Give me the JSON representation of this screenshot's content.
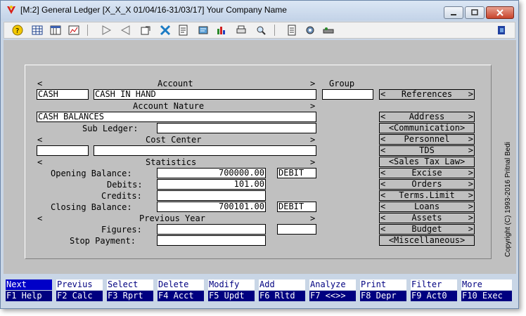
{
  "window": {
    "title": "[M:2]  General Ledger  [X_X_X  01/04/16-31/03/17]  Your Company Name"
  },
  "toolbar": {
    "icons": [
      "help-icon",
      "grid-icon",
      "table-icon",
      "chart-icon",
      "next-arrow-icon",
      "prev-arrow-icon",
      "properties-icon",
      "tools-icon",
      "document-icon",
      "refresh-icon",
      "bar-chart-icon",
      "print-icon",
      "find-icon",
      "notes-icon",
      "settings-icon",
      "switch-icon",
      "exit-icon"
    ]
  },
  "form": {
    "left_bracket": "<",
    "right_bracket": ">",
    "account_label": "Account",
    "account_code": "CASH",
    "account_name": "CASH IN HAND",
    "group_label": "Group",
    "group_value": "",
    "account_nature_label": "Account Nature",
    "account_nature_value": "CASH BALANCES",
    "sub_ledger_label": "Sub Ledger:",
    "sub_ledger_value": "",
    "cost_center_label": "Cost Center",
    "cost_center_code": "",
    "cost_center_name": "",
    "statistics_label": "Statistics",
    "opening_balance_label": "Opening Balance:",
    "opening_balance_value": "700000.00",
    "opening_balance_type": "DEBIT",
    "debits_label": "Debits:",
    "debits_value": "101.00",
    "credits_label": "Credits:",
    "credits_value": "",
    "closing_balance_label": "Closing Balance:",
    "closing_balance_value": "700101.00",
    "closing_balance_type": "DEBIT",
    "previous_year_label": "Previous Year",
    "figures_label": "Figures:",
    "figures_value": "",
    "figures_type": "",
    "stop_payment_label": "Stop Payment:",
    "stop_payment_value": ""
  },
  "side_buttons": {
    "references": "References",
    "address": "Address",
    "communication": "<Communication>",
    "personnel": "Personnel",
    "tds": "TDS",
    "sales_tax_law": "<Sales Tax Law>",
    "excise": "Excise",
    "orders": "Orders",
    "terms_limit": "Terms.Limit",
    "loans": "Loans",
    "assets": "Assets",
    "budget": "Budget",
    "miscellaneous": "<Miscellaneous>"
  },
  "copyright": "Copyright (C) 1993-2016  Pritnal Bedi",
  "function_keys": [
    {
      "top": "Next",
      "bottom": "F1 Help"
    },
    {
      "top": "Previus",
      "bottom": "F2 Calc"
    },
    {
      "top": "Select",
      "bottom": "F3 Rprt"
    },
    {
      "top": "Delete",
      "bottom": "F4 Acct"
    },
    {
      "top": "Modify",
      "bottom": "F5 Updt"
    },
    {
      "top": "Add",
      "bottom": "F6 Rltd"
    },
    {
      "top": "Analyze",
      "bottom": "F7 <<>>"
    },
    {
      "top": "Print",
      "bottom": "F8 Depr"
    },
    {
      "top": "Filter",
      "bottom": "F9 Act0"
    },
    {
      "top": "More",
      "bottom": "F10 Exec"
    }
  ],
  "colors": {
    "function_key_bar": "#000080",
    "active_key": "#0000c8",
    "form_background": "#c0c0c0"
  }
}
